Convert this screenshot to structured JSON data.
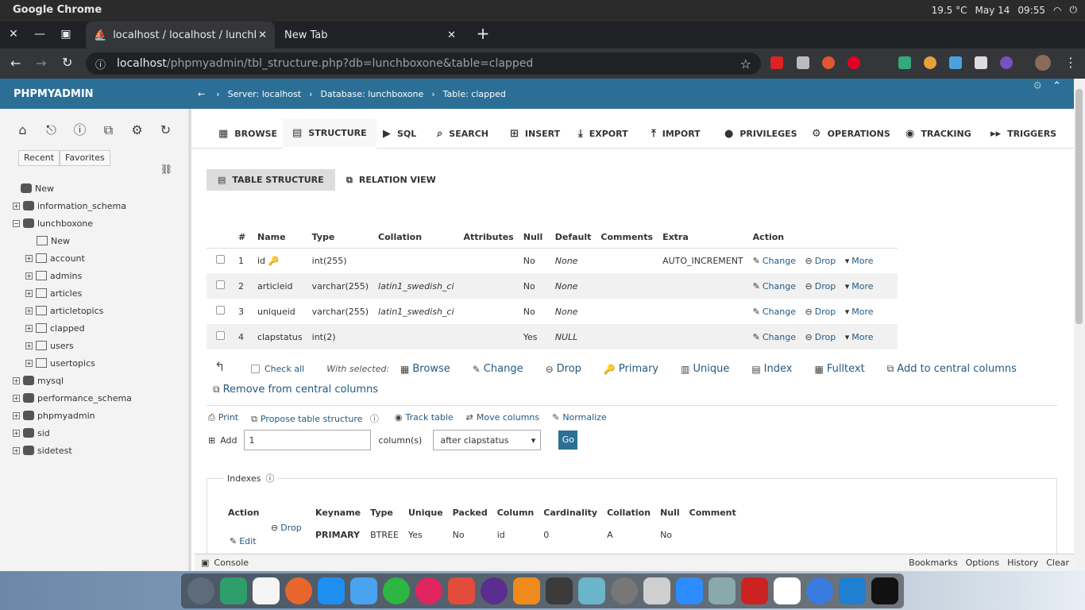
{
  "os": {
    "app": "Google Chrome",
    "temp": "19.5 °C",
    "date": "May 14",
    "time": "09:55"
  },
  "browser": {
    "tabs": [
      {
        "label": "localhost / localhost / lunchb"
      },
      {
        "label": "New Tab"
      }
    ],
    "url_host": "localhost",
    "url_path": "/phpmyadmin/tbl_structure.php?db=lunchboxone&table=clapped"
  },
  "pma": {
    "logo": "PHPMYADMIN",
    "breadcrumb": {
      "arrow": "←",
      "server": "Server: localhost",
      "database": "Database: lunchboxone",
      "table": "Table: clapped"
    },
    "left": {
      "recent": "Recent",
      "favorites": "Favorites",
      "tree": [
        {
          "label": "New",
          "level": 0
        },
        {
          "label": "information_schema",
          "level": 0
        },
        {
          "label": "lunchboxone",
          "level": 0
        },
        {
          "label": "New",
          "level": 1
        },
        {
          "label": "account",
          "level": 1
        },
        {
          "label": "admins",
          "level": 1
        },
        {
          "label": "articles",
          "level": 1
        },
        {
          "label": "articletopics",
          "level": 1
        },
        {
          "label": "clapped",
          "level": 1
        },
        {
          "label": "users",
          "level": 1
        },
        {
          "label": "usertopics",
          "level": 1
        },
        {
          "label": "mysql",
          "level": 0
        },
        {
          "label": "performance_schema",
          "level": 0
        },
        {
          "label": "phpmyadmin",
          "level": 0
        },
        {
          "label": "sid",
          "level": 0
        },
        {
          "label": "sidetest",
          "level": 0
        }
      ]
    },
    "tabs": [
      {
        "label": "BROWSE",
        "icon": "▦"
      },
      {
        "label": "STRUCTURE",
        "icon": "▤"
      },
      {
        "label": "SQL",
        "icon": "▶"
      },
      {
        "label": "SEARCH",
        "icon": "⌕"
      },
      {
        "label": "INSERT",
        "icon": "⊞"
      },
      {
        "label": "EXPORT",
        "icon": "⤓"
      },
      {
        "label": "IMPORT",
        "icon": "⤒"
      },
      {
        "label": "PRIVILEGES",
        "icon": "●"
      },
      {
        "label": "OPERATIONS",
        "icon": "⚙"
      },
      {
        "label": "TRACKING",
        "icon": "◉"
      },
      {
        "label": "TRIGGERS",
        "icon": "▸▸"
      }
    ],
    "subtabs": {
      "table_structure": "TABLE STRUCTURE",
      "relation_view": "RELATION VIEW"
    },
    "structure": {
      "headers": [
        "#",
        "Name",
        "Type",
        "Collation",
        "Attributes",
        "Null",
        "Default",
        "Comments",
        "Extra",
        "Action"
      ],
      "rows": [
        {
          "num": "1",
          "name": "id",
          "type": "int(255)",
          "collation": "",
          "null": "No",
          "default": "None",
          "extra": "AUTO_INCREMENT"
        },
        {
          "num": "2",
          "name": "articleid",
          "type": "varchar(255)",
          "collation": "latin1_swedish_ci",
          "null": "No",
          "default": "None",
          "extra": ""
        },
        {
          "num": "3",
          "name": "uniqueid",
          "type": "varchar(255)",
          "collation": "latin1_swedish_ci",
          "null": "No",
          "default": "None",
          "extra": ""
        },
        {
          "num": "4",
          "name": "clapstatus",
          "type": "int(2)",
          "collation": "",
          "null": "Yes",
          "default": "NULL",
          "extra": ""
        }
      ],
      "actions": {
        "change": "Change",
        "drop": "Drop",
        "more": "More"
      }
    },
    "with_selected": {
      "check_all": "Check all",
      "label": "With selected:",
      "browse": "Browse",
      "change": "Change",
      "drop": "Drop",
      "primary": "Primary",
      "unique": "Unique",
      "index": "Index",
      "fulltext": "Fulltext",
      "add_central": "Add to central columns",
      "remove_central": "Remove from central columns"
    },
    "footer_links": {
      "print": "Print",
      "propose": "Propose table structure",
      "track": "Track table",
      "move": "Move columns",
      "normalize": "Normalize"
    },
    "add": {
      "label": "Add",
      "value": "1",
      "columns": "column(s)",
      "position": "after clapstatus",
      "go": "Go"
    },
    "indexes": {
      "legend": "Indexes",
      "headers": [
        "Action",
        "Keyname",
        "Type",
        "Unique",
        "Packed",
        "Column",
        "Cardinality",
        "Collation",
        "Null",
        "Comment"
      ],
      "row": {
        "drop": "Drop",
        "edit": "Edit",
        "keyname": "PRIMARY",
        "type": "BTREE",
        "unique": "Yes",
        "packed": "No",
        "column": "id",
        "cardinality": "0",
        "collation": "A",
        "null": "No",
        "comment": ""
      }
    },
    "console": {
      "label": "Console",
      "bookmarks": "Bookmarks",
      "options": "Options",
      "history": "History",
      "clear": "Clear"
    }
  },
  "colors": {
    "pma_blue": "#2b6f96",
    "link": "#235a81"
  }
}
